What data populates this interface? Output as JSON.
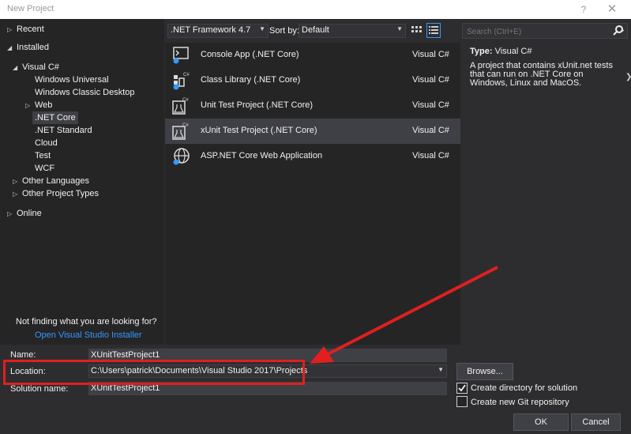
{
  "window": {
    "title": "New Project",
    "help": "?",
    "close": "✕"
  },
  "tree": {
    "recent": "Recent",
    "installed": "Installed",
    "visual_csharp": "Visual C#",
    "windows_universal": "Windows Universal",
    "windows_classic": "Windows Classic Desktop",
    "web": "Web",
    "net_core": ".NET Core",
    "net_standard": ".NET Standard",
    "cloud": "Cloud",
    "test": "Test",
    "wcf": "WCF",
    "other_languages": "Other Languages",
    "other_project_types": "Other Project Types",
    "online": "Online",
    "not_finding": "Not finding what you are looking for?",
    "open_installer": "Open Visual Studio Installer"
  },
  "toolbar": {
    "framework": ".NET Framework 4.7",
    "sort_by_label": "Sort by:",
    "sort_value": "Default"
  },
  "templates": [
    {
      "name": "Console App (.NET Core)",
      "lang": "Visual C#",
      "icon": "console-app-icon"
    },
    {
      "name": "Class Library (.NET Core)",
      "lang": "Visual C#",
      "icon": "class-library-icon"
    },
    {
      "name": "Unit Test Project (.NET Core)",
      "lang": "Visual C#",
      "icon": "unit-test-icon"
    },
    {
      "name": "xUnit Test Project (.NET Core)",
      "lang": "Visual C#",
      "icon": "xunit-test-icon",
      "selected": true
    },
    {
      "name": "ASP.NET Core Web Application",
      "lang": "Visual C#",
      "icon": "globe-icon"
    }
  ],
  "search": {
    "placeholder": "Search (Ctrl+E)"
  },
  "details": {
    "type_label": "Type:",
    "type_value": "Visual C#",
    "description": "A project that contains xUnit.net tests that can run on .NET Core on Windows, Linux and MacOS."
  },
  "form": {
    "name_label": "Name:",
    "name_value": "XUnitTestProject1",
    "location_label": "Location:",
    "location_value": "C:\\Users\\patrick\\Documents\\Visual Studio 2017\\Projects",
    "solution_label": "Solution name:",
    "solution_value": "XUnitTestProject1",
    "browse": "Browse...",
    "create_dir": "Create directory for solution",
    "create_dir_checked": true,
    "create_git": "Create new Git repository",
    "create_git_checked": false,
    "ok": "OK",
    "cancel": "Cancel"
  },
  "colors": {
    "accent": "#3399ff",
    "annotation": "#e01f1f",
    "background": "#2d2d30"
  }
}
